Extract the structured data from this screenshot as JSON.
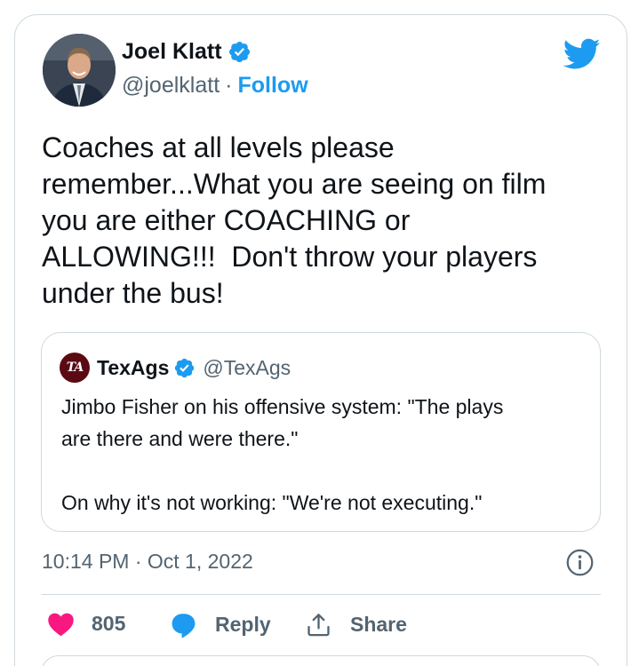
{
  "author": {
    "name": "Joel Klatt",
    "handle": "@joelklatt",
    "separator": "·",
    "follow_label": "Follow"
  },
  "tweet": {
    "text": "Coaches at all levels please\nremember...What you are seeing on film\nyou are either COACHING or\nALLOWING!!!  Don't throw your players\nunder the bus!",
    "timestamp": "10:14 PM · Oct 1, 2022"
  },
  "quoted": {
    "logo_text": "TA",
    "name": "TexAgs",
    "handle": "@TexAgs",
    "text": "Jimbo Fisher on his offensive system: \"The plays\nare there and were there.\"\n\nOn why it's not working: \"We're not executing.\""
  },
  "actions": {
    "likes": "805",
    "reply_label": "Reply",
    "share_label": "Share"
  },
  "colors": {
    "accent": "#1d9bf0",
    "like": "#f91880",
    "secondary_text": "#536471",
    "border": "#cfd9de",
    "texags_maroon": "#5b0a13"
  },
  "icons": [
    "verified-badge-icon",
    "twitter-bird-icon",
    "texags-logo-icon",
    "info-icon",
    "heart-icon",
    "reply-icon",
    "share-icon"
  ]
}
